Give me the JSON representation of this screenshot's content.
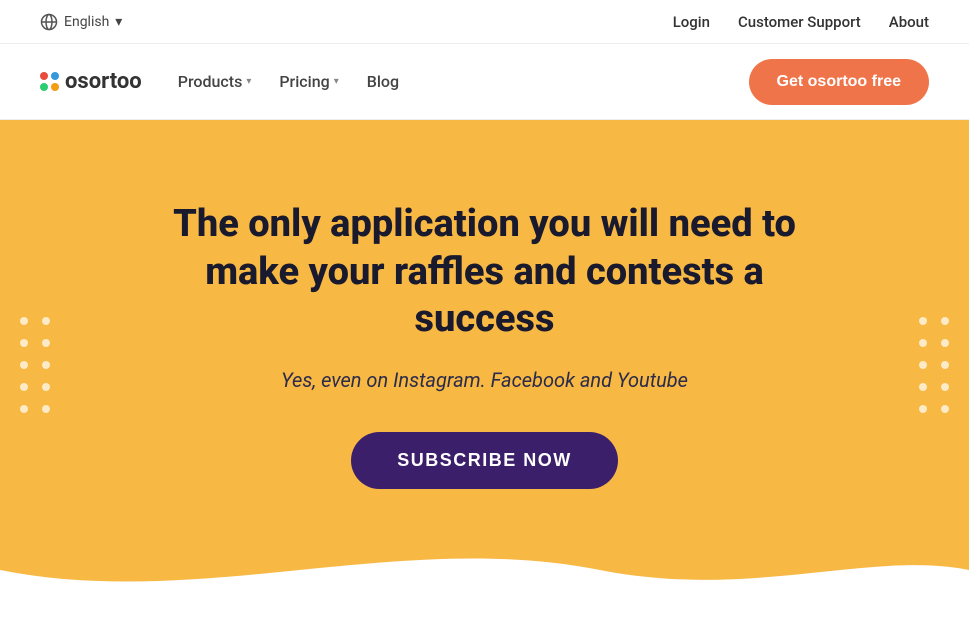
{
  "topbar": {
    "language": "English",
    "login": "Login",
    "customer_support": "Customer Support",
    "about": "About"
  },
  "nav": {
    "logo_text": "osortoo",
    "products": "Products",
    "pricing": "Pricing",
    "blog": "Blog",
    "cta": "Get osortoo free"
  },
  "hero": {
    "headline_line1": "The only application you will need to",
    "headline_line2": "make your raffles and contests a success",
    "subtext": "Yes, even on Instagram. Facebook and Youtube",
    "subscribe": "SUBSCRIBE NOW"
  },
  "logo_colors": {
    "dot1": "#e74c3c",
    "dot2": "#3498db",
    "dot3": "#2ecc71",
    "dot4": "#f39c12",
    "dot5": "#9b59b6"
  }
}
